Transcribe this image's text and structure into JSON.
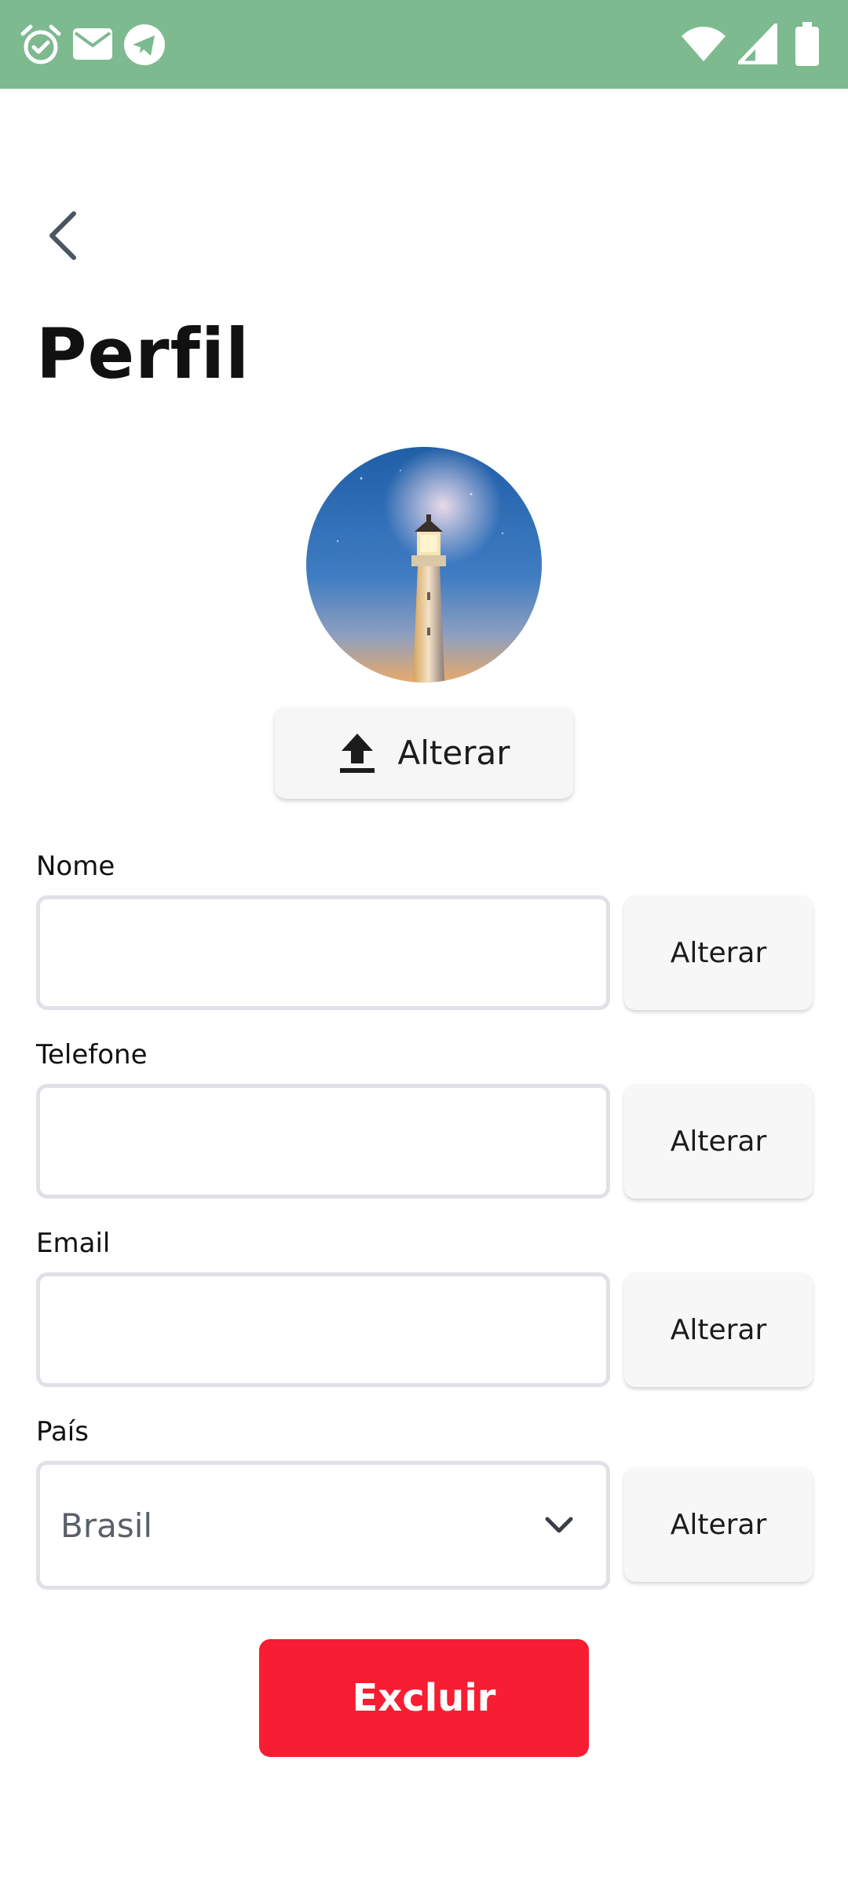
{
  "status_bar": {
    "left_icons": [
      "alarm-icon",
      "mail-icon",
      "telegram-icon"
    ],
    "right_icons": [
      "wifi-icon",
      "signal-icon",
      "battery-icon"
    ],
    "background": "#7dba8f"
  },
  "header": {
    "back_icon": "chevron-left-icon",
    "title": "Perfil"
  },
  "profile": {
    "avatar_icon": "lighthouse-photo",
    "change_photo_label": "Alterar",
    "change_photo_icon": "upload-icon"
  },
  "form": {
    "fields": [
      {
        "label": "Nome",
        "value": "",
        "button": "Alterar"
      },
      {
        "label": "Telefone",
        "value": "",
        "button": "Alterar"
      },
      {
        "label": "Email",
        "value": "",
        "button": "Alterar"
      }
    ],
    "country": {
      "label": "País",
      "selected": "Brasil",
      "button": "Alterar",
      "icon": "chevron-down-icon"
    }
  },
  "actions": {
    "delete_label": "Excluir",
    "delete_color": "#f71d32"
  }
}
